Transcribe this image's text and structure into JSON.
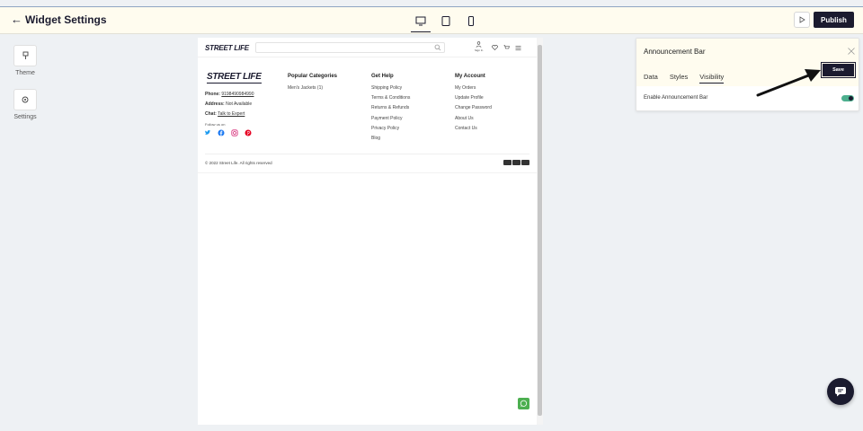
{
  "app": {
    "back_glyph": "←",
    "title": "Widget Settings",
    "publish_label": "Publish"
  },
  "devices": [
    "desktop-icon",
    "tablet-icon",
    "mobile-icon"
  ],
  "sidebar": {
    "items": [
      {
        "label": "Theme",
        "icon": "brush-icon"
      },
      {
        "label": "Settings",
        "icon": "gear-icon"
      }
    ]
  },
  "preview": {
    "logo": "STREET LIFE",
    "header_sign_in": "Sign In",
    "footer": {
      "brand": "STREET LIFE",
      "phone_label": "Phone:",
      "phone_value": "9198490984990",
      "address_label": "Address:",
      "address_value": "Not Available",
      "chat_label": "Chat:",
      "chat_value": "Talk to Expert",
      "follow_label": "Follow us on",
      "columns": [
        {
          "heading": "Popular Categories",
          "links": [
            "Men's Jackets (1)"
          ]
        },
        {
          "heading": "Get Help",
          "links": [
            "Shipping Policy",
            "Terms & Conditions",
            "Returns & Refunds",
            "Payment Policy",
            "Privacy Policy",
            "Blog"
          ]
        },
        {
          "heading": "My Account",
          "links": [
            "My Orders",
            "Update Profile",
            "Change Password",
            "About Us",
            "Contact Us"
          ]
        }
      ],
      "copyright": "© 2022 Street Life. All rights reserved"
    }
  },
  "panel": {
    "title": "Announcement Bar",
    "save_label": "Save",
    "tabs": [
      "Data",
      "Styles",
      "Visibility"
    ],
    "active_tab": "Visibility",
    "toggle_label": "Enable Announcement Bar",
    "toggle_on": true
  },
  "colors": {
    "dark": "#1b1b2f",
    "topbar_bg": "#fffcef",
    "toggle_on": "#4caf8e",
    "whatsapp": "#4caf50"
  }
}
